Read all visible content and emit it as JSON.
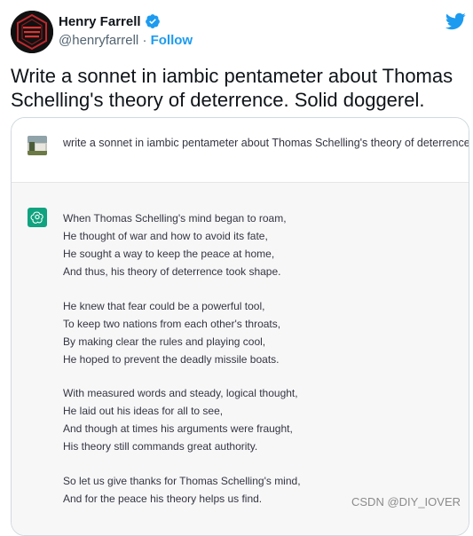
{
  "author": {
    "name": "Henry Farrell",
    "handle": "@henryfarrell",
    "separator": "·",
    "follow_label": "Follow",
    "verified_icon": "verified-badge-icon",
    "avatar_icon": "profile-avatar"
  },
  "brand": {
    "icon": "twitter-bird-icon",
    "color": "#1d9bf0"
  },
  "tweet": {
    "text": "Write a sonnet in iambic pentameter about Thomas Schelling's theory of deterrence. Solid doggerel."
  },
  "card": {
    "prompt": "write a sonnet in iambic pentameter about Thomas Schelling's theory of deterrence",
    "assistant_icon": "openai-logo-icon",
    "assistant_color": "#10a37f",
    "stanzas": [
      {
        "lines": [
          "When Thomas Schelling's mind began to roam,",
          "He thought of war and how to avoid its fate,",
          "He sought a way to keep the peace at home,",
          "And thus, his theory of deterrence took shape."
        ]
      },
      {
        "lines": [
          "He knew that fear could be a powerful tool,",
          "To keep two nations from each other's throats,",
          "By making clear the rules and playing cool,",
          "He hoped to prevent the deadly missile boats."
        ]
      },
      {
        "lines": [
          "With measured words and steady, logical thought,",
          "He laid out his ideas for all to see,",
          "And though at times his arguments were fraught,",
          "His theory still commands great authority."
        ]
      },
      {
        "lines": [
          "So let us give thanks for Thomas Schelling's mind,",
          "And for the peace his theory helps us find."
        ]
      }
    ]
  },
  "watermark": "CSDN @DIY_IOVER"
}
